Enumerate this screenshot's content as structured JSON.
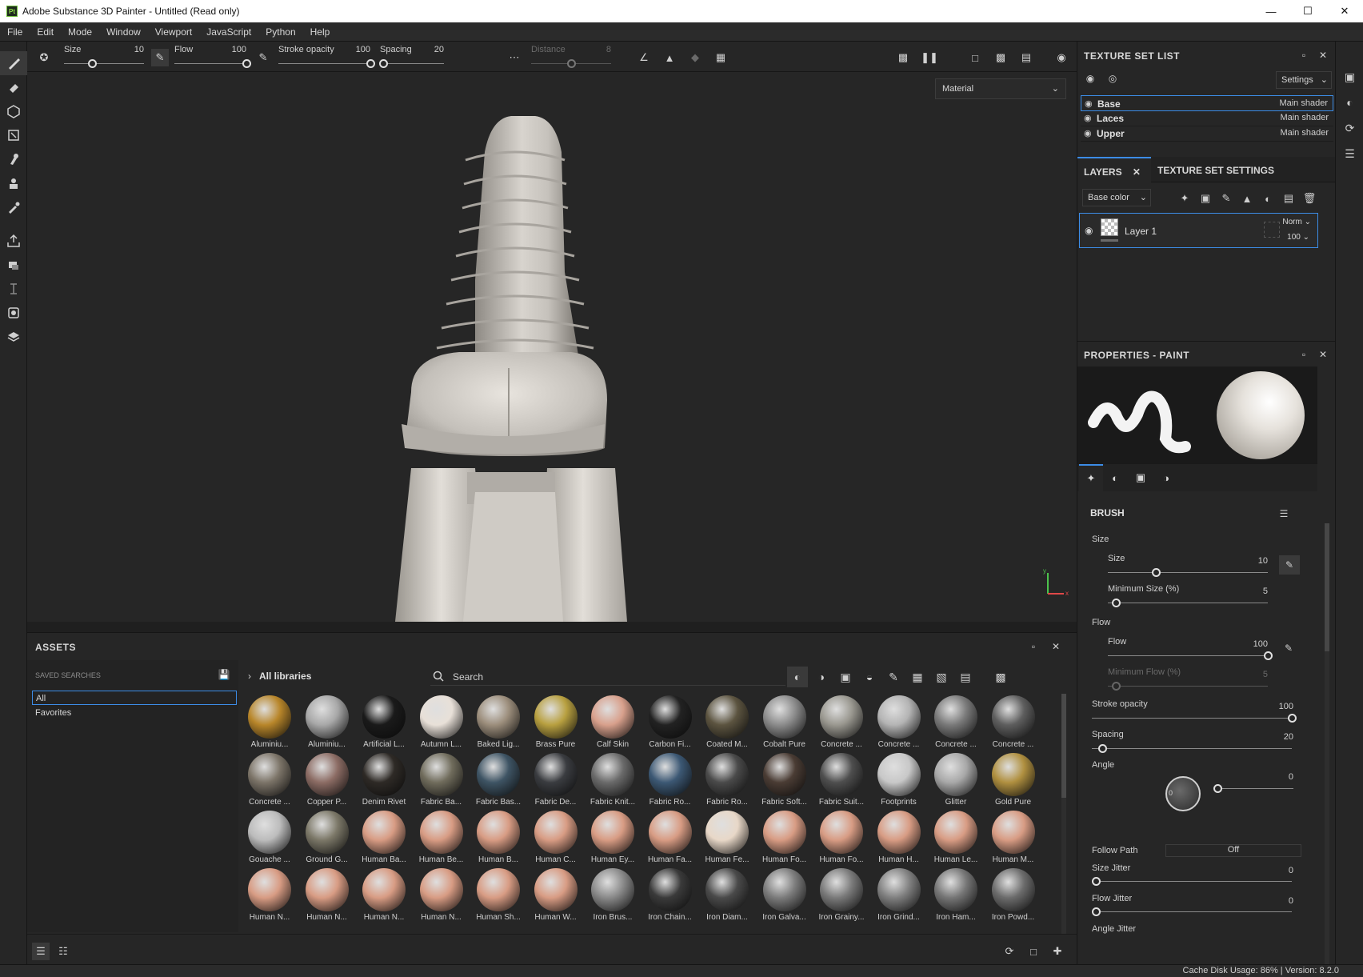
{
  "window": {
    "title": "Adobe Substance 3D Painter - Untitled (Read only)",
    "app_badge": "Pt",
    "controls": [
      "minimize-icon",
      "maximize-icon",
      "close-icon"
    ]
  },
  "menu": [
    "File",
    "Edit",
    "Mode",
    "Window",
    "Viewport",
    "JavaScript",
    "Python",
    "Help"
  ],
  "left_tools": [
    "paint-brush-icon",
    "eraser-icon",
    "projection-icon",
    "polygon-fill-icon",
    "smudge-icon",
    "clone-icon",
    "color-picker-icon",
    "export-icon",
    "bake-icon",
    "dimension-icon",
    "render-icon",
    "resources-icon"
  ],
  "options_bar": {
    "size": {
      "label": "Size",
      "value": "10",
      "fraction": 0.35
    },
    "flow": {
      "label": "Flow",
      "value": "100",
      "fraction": 1.0
    },
    "stroke_opacity": {
      "label": "Stroke opacity",
      "value": "100",
      "fraction": 1.0
    },
    "spacing": {
      "label": "Spacing",
      "value": "20",
      "fraction": 0.05
    },
    "distance": {
      "label": "Distance",
      "value": "8",
      "fraction": 0.5
    }
  },
  "viewport": {
    "mode": "Material",
    "axis_labels": [
      "y",
      "x"
    ]
  },
  "assets": {
    "title": "ASSETS",
    "saved_searches_title": "SAVED SEARCHES",
    "saved_items": [
      "All",
      "Favorites"
    ],
    "library_path": "All libraries",
    "search_placeholder": "Search",
    "filters": [
      "materials-filter-icon",
      "smart-materials-filter-icon",
      "masks-filter-icon",
      "filters-filter-icon",
      "brushes-filter-icon",
      "textures-filter-icon",
      "alphas-filter-icon",
      "environments-filter-icon"
    ],
    "items": [
      {
        "label": "Aluminiu...",
        "color": "#b8862a"
      },
      {
        "label": "Aluminiu...",
        "color": "#a8a8a8"
      },
      {
        "label": "Artificial L...",
        "color": "#1a1a1a"
      },
      {
        "label": "Autumn L...",
        "color": "#e8e0d8"
      },
      {
        "label": "Baked Lig...",
        "color": "#9c8e7c"
      },
      {
        "label": "Brass Pure",
        "color": "#b8a040"
      },
      {
        "label": "Calf Skin",
        "color": "#d8a08c"
      },
      {
        "label": "Carbon Fi...",
        "color": "#222222"
      },
      {
        "label": "Coated M...",
        "color": "#5c5440"
      },
      {
        "label": "Cobalt Pure",
        "color": "#8c8c8c"
      },
      {
        "label": "Concrete ...",
        "color": "#9a9890"
      },
      {
        "label": "Concrete ...",
        "color": "#b4b4b4"
      },
      {
        "label": "Concrete ...",
        "color": "#7a7a7a"
      },
      {
        "label": "Concrete ...",
        "color": "#5e5e5e"
      },
      {
        "label": "Concrete ...",
        "color": "#7c7468"
      },
      {
        "label": "Copper P...",
        "color": "#8c6c64"
      },
      {
        "label": "Denim Rivet",
        "color": "#2e2a26"
      },
      {
        "label": "Fabric Ba...",
        "color": "#706c5c"
      },
      {
        "label": "Fabric Bas...",
        "color": "#3e5464"
      },
      {
        "label": "Fabric De...",
        "color": "#3a3c40"
      },
      {
        "label": "Fabric Knit...",
        "color": "#6a6a6a"
      },
      {
        "label": "Fabric Ro...",
        "color": "#3c5874"
      },
      {
        "label": "Fabric Ro...",
        "color": "#4a4a4a"
      },
      {
        "label": "Fabric Soft...",
        "color": "#4a3c34"
      },
      {
        "label": "Fabric Suit...",
        "color": "#4e4e4e"
      },
      {
        "label": "Footprints",
        "color": "#c8c8c8"
      },
      {
        "label": "Glitter",
        "color": "#a8a8a8"
      },
      {
        "label": "Gold Pure",
        "color": "#b09040"
      },
      {
        "label": "Gouache ...",
        "color": "#bcbcbc"
      },
      {
        "label": "Ground G...",
        "color": "#7c7868"
      },
      {
        "label": "Human Ba...",
        "color": "#d89c84"
      },
      {
        "label": "Human Be...",
        "color": "#d89c84"
      },
      {
        "label": "Human B...",
        "color": "#d89c84"
      },
      {
        "label": "Human C...",
        "color": "#d89c84"
      },
      {
        "label": "Human Ey...",
        "color": "#d89c84"
      },
      {
        "label": "Human Fa...",
        "color": "#d89c84"
      },
      {
        "label": "Human Fe...",
        "color": "#e8d8c8"
      },
      {
        "label": "Human Fo...",
        "color": "#d89c84"
      },
      {
        "label": "Human Fo...",
        "color": "#d89c84"
      },
      {
        "label": "Human H...",
        "color": "#d89c84"
      },
      {
        "label": "Human Le...",
        "color": "#d89c84"
      },
      {
        "label": "Human M...",
        "color": "#d89c84"
      },
      {
        "label": "Human N...",
        "color": "#d89c84"
      },
      {
        "label": "Human N...",
        "color": "#d89c84"
      },
      {
        "label": "Human N...",
        "color": "#d89c84"
      },
      {
        "label": "Human N...",
        "color": "#d89c84"
      },
      {
        "label": "Human Sh...",
        "color": "#d89c84"
      },
      {
        "label": "Human W...",
        "color": "#d89c84"
      },
      {
        "label": "Iron Brus...",
        "color": "#8a8a8a"
      },
      {
        "label": "Iron Chain...",
        "color": "#3a3a3a"
      },
      {
        "label": "Iron Diam...",
        "color": "#4a4a4a"
      },
      {
        "label": "Iron Galva...",
        "color": "#7c7c7c"
      },
      {
        "label": "Iron Grainy...",
        "color": "#7a7a7a"
      },
      {
        "label": "Iron Grind...",
        "color": "#808080"
      },
      {
        "label": "Iron Ham...",
        "color": "#767676"
      },
      {
        "label": "Iron Powd...",
        "color": "#6c6c6c"
      }
    ]
  },
  "texture_set_list": {
    "title": "TEXTURE SET LIST",
    "settings_label": "Settings",
    "rows": [
      {
        "name": "Base",
        "shader": "Main shader"
      },
      {
        "name": "Laces",
        "shader": "Main shader"
      },
      {
        "name": "Upper",
        "shader": "Main shader"
      }
    ]
  },
  "layers": {
    "tab_layers": "LAYERS",
    "tab_tss": "TEXTURE SET SETTINGS",
    "channel": "Base color",
    "tools": [
      "add-effect-icon",
      "add-mask-icon",
      "add-paint-layer-icon",
      "add-fill-layer-icon",
      "add-smart-material-icon",
      "add-folder-icon",
      "delete-icon"
    ],
    "rows": [
      {
        "name": "Layer 1",
        "blend": "Norm",
        "opacity": "100"
      }
    ]
  },
  "properties": {
    "title": "PROPERTIES - PAINT",
    "tabs": [
      "brush-tab-icon",
      "material-tab-icon",
      "stencil-tab-icon",
      "sphere-tab-icon"
    ],
    "brush_title": "BRUSH",
    "size_group": "Size",
    "size_label": "Size",
    "size_value": "10",
    "size_fraction": 0.3,
    "min_size_label": "Minimum Size (%)",
    "min_size_value": "5",
    "min_size_fraction": 0.05,
    "flow_group": "Flow",
    "flow_label": "Flow",
    "flow_value": "100",
    "flow_fraction": 1.0,
    "min_flow_label": "Minimum Flow (%)",
    "min_flow_value": "5",
    "min_flow_fraction": 0.05,
    "stroke_opacity_label": "Stroke opacity",
    "stroke_opacity_value": "100",
    "stroke_opacity_fraction": 1.0,
    "spacing_label": "Spacing",
    "spacing_value": "20",
    "spacing_fraction": 0.05,
    "angle_label": "Angle",
    "angle_value": "0",
    "angle_dial_value": "0",
    "follow_path_label": "Follow Path",
    "follow_path_value": "Off",
    "size_jitter_label": "Size Jitter",
    "size_jitter_value": "0",
    "flow_jitter_label": "Flow Jitter",
    "flow_jitter_value": "0",
    "angle_jitter_label": "Angle Jitter"
  },
  "status": {
    "text": "Cache Disk Usage:   86% | Version: 8.2.0"
  }
}
